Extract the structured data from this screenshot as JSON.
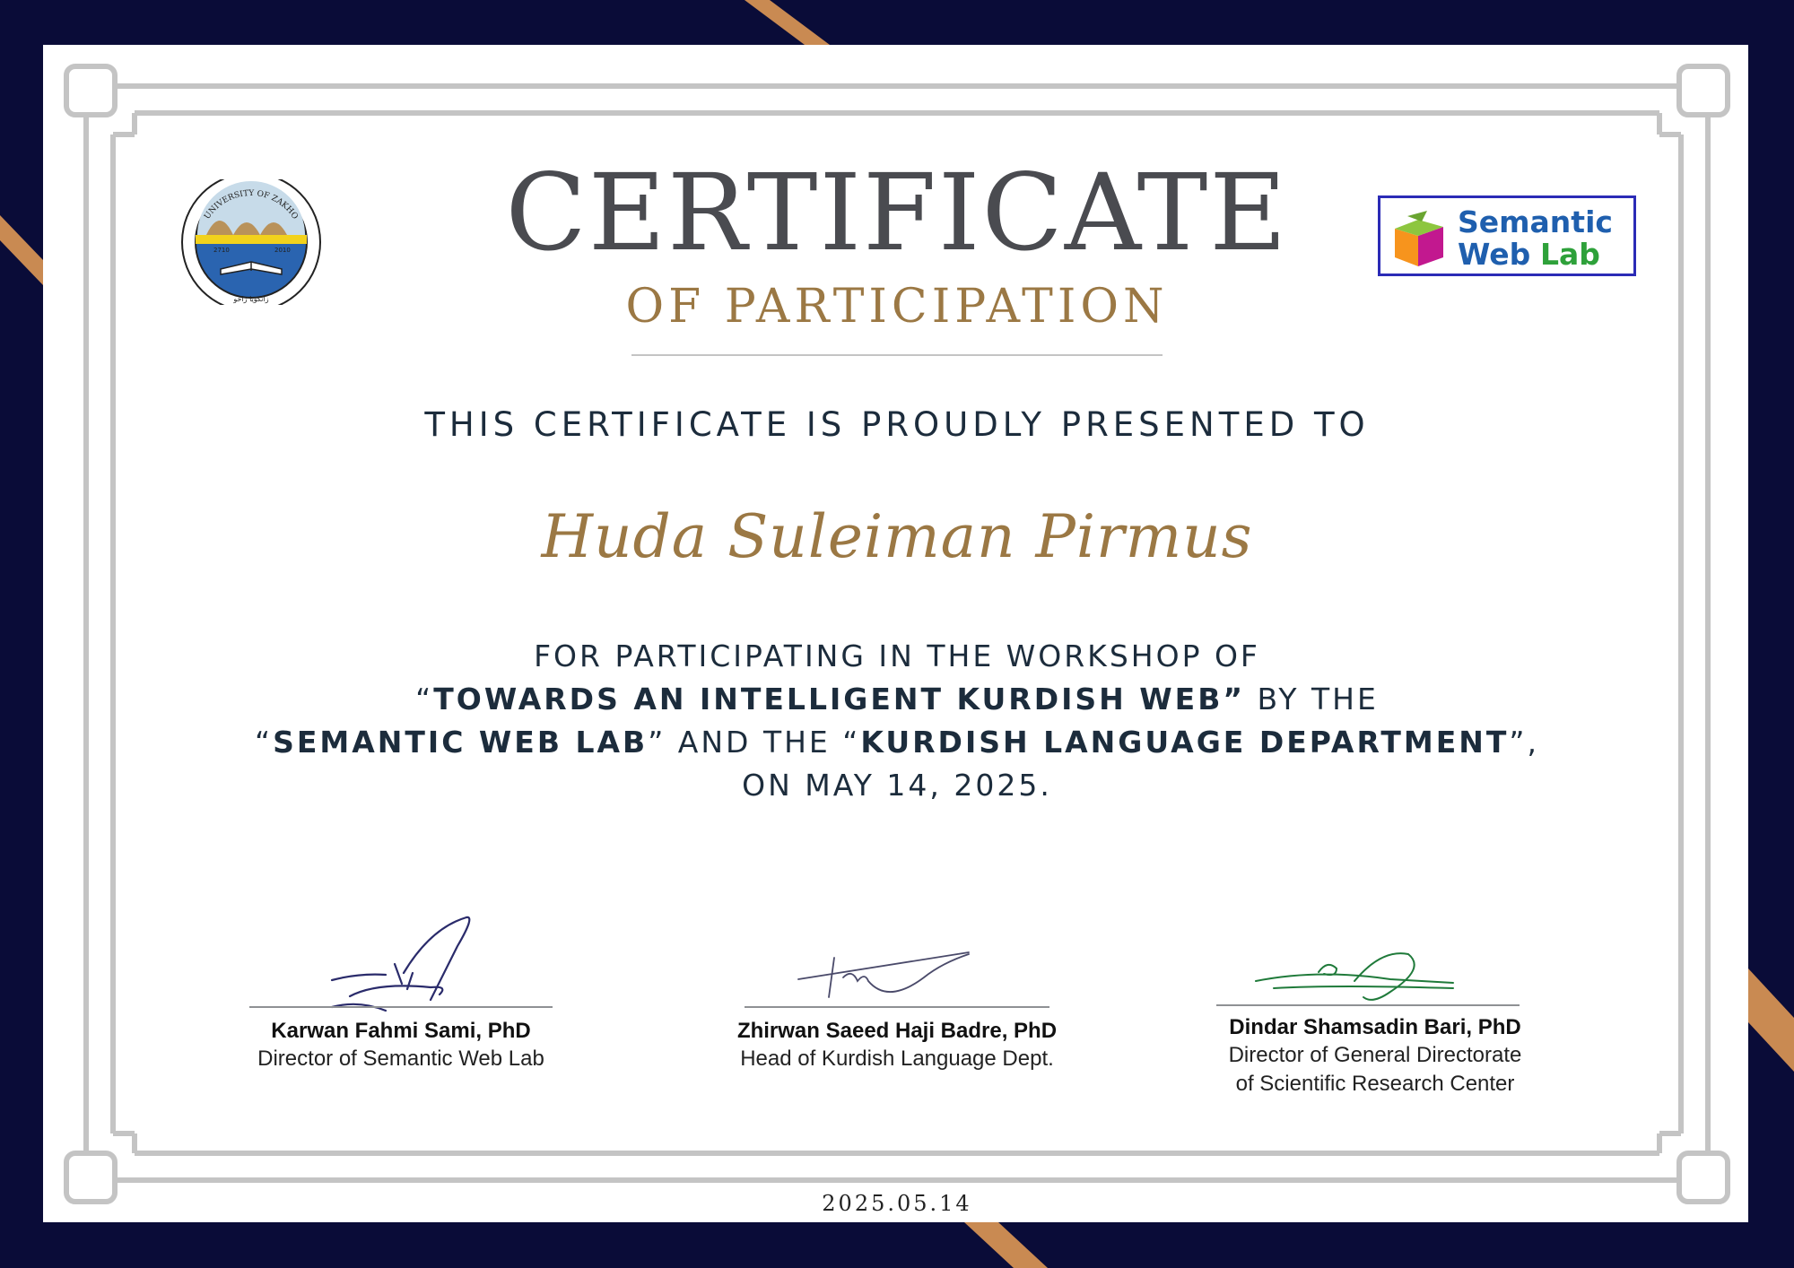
{
  "certificate": {
    "title": "CERTIFICATE",
    "subtitle": "OF PARTICIPATION",
    "presented_to": "THIS CERTIFICATE IS PROUDLY PRESENTED TO",
    "recipient": "Huda Suleiman Pirmus",
    "body": {
      "line1": "FOR PARTICIPATING IN THE WORKSHOP OF",
      "line2_q1": "“",
      "line2_bold": "TOWARDS AN INTELLIGENT KURDISH WEB”",
      "line2_rest": " BY THE",
      "line3_q1": "“",
      "line3_bold1": "SEMANTIC WEB LAB",
      "line3_mid": "” AND THE “",
      "line3_bold2": "KURDISH LANGUAGE DEPARTMENT",
      "line3_end": "”,",
      "line4": "ON MAY 14, 2025."
    },
    "date_footer": "2025.05.14"
  },
  "logos": {
    "university": {
      "ring_text": "UNIVERSITY OF ZAKHO",
      "left_year": "2710",
      "right_year": "2010",
      "bottom_text": "زانكويا زاخو"
    },
    "lab": {
      "line1": "Semantic",
      "line2_a": "Web",
      "line2_b": "Lab"
    }
  },
  "signatories": [
    {
      "name": "Karwan Fahmi Sami, PhD",
      "title_lines": [
        "Director of Semantic Web Lab"
      ]
    },
    {
      "name": "Zhirwan Saeed Haji Badre, PhD",
      "title_lines": [
        "Head of Kurdish Language Dept."
      ]
    },
    {
      "name": "Dindar Shamsadin Bari, PhD",
      "title_lines": [
        "Director of General Directorate",
        "of Scientific Research Center"
      ]
    }
  ],
  "colors": {
    "navy_background": "#0a0c38",
    "gold_accent": "#9b7844",
    "copper_stripe": "#c98a52",
    "frame_grey": "#c4c4c4",
    "lab_border": "#2b2bb6",
    "lab_text_blue": "#1f5fae",
    "lab_text_green": "#2ea13a"
  }
}
